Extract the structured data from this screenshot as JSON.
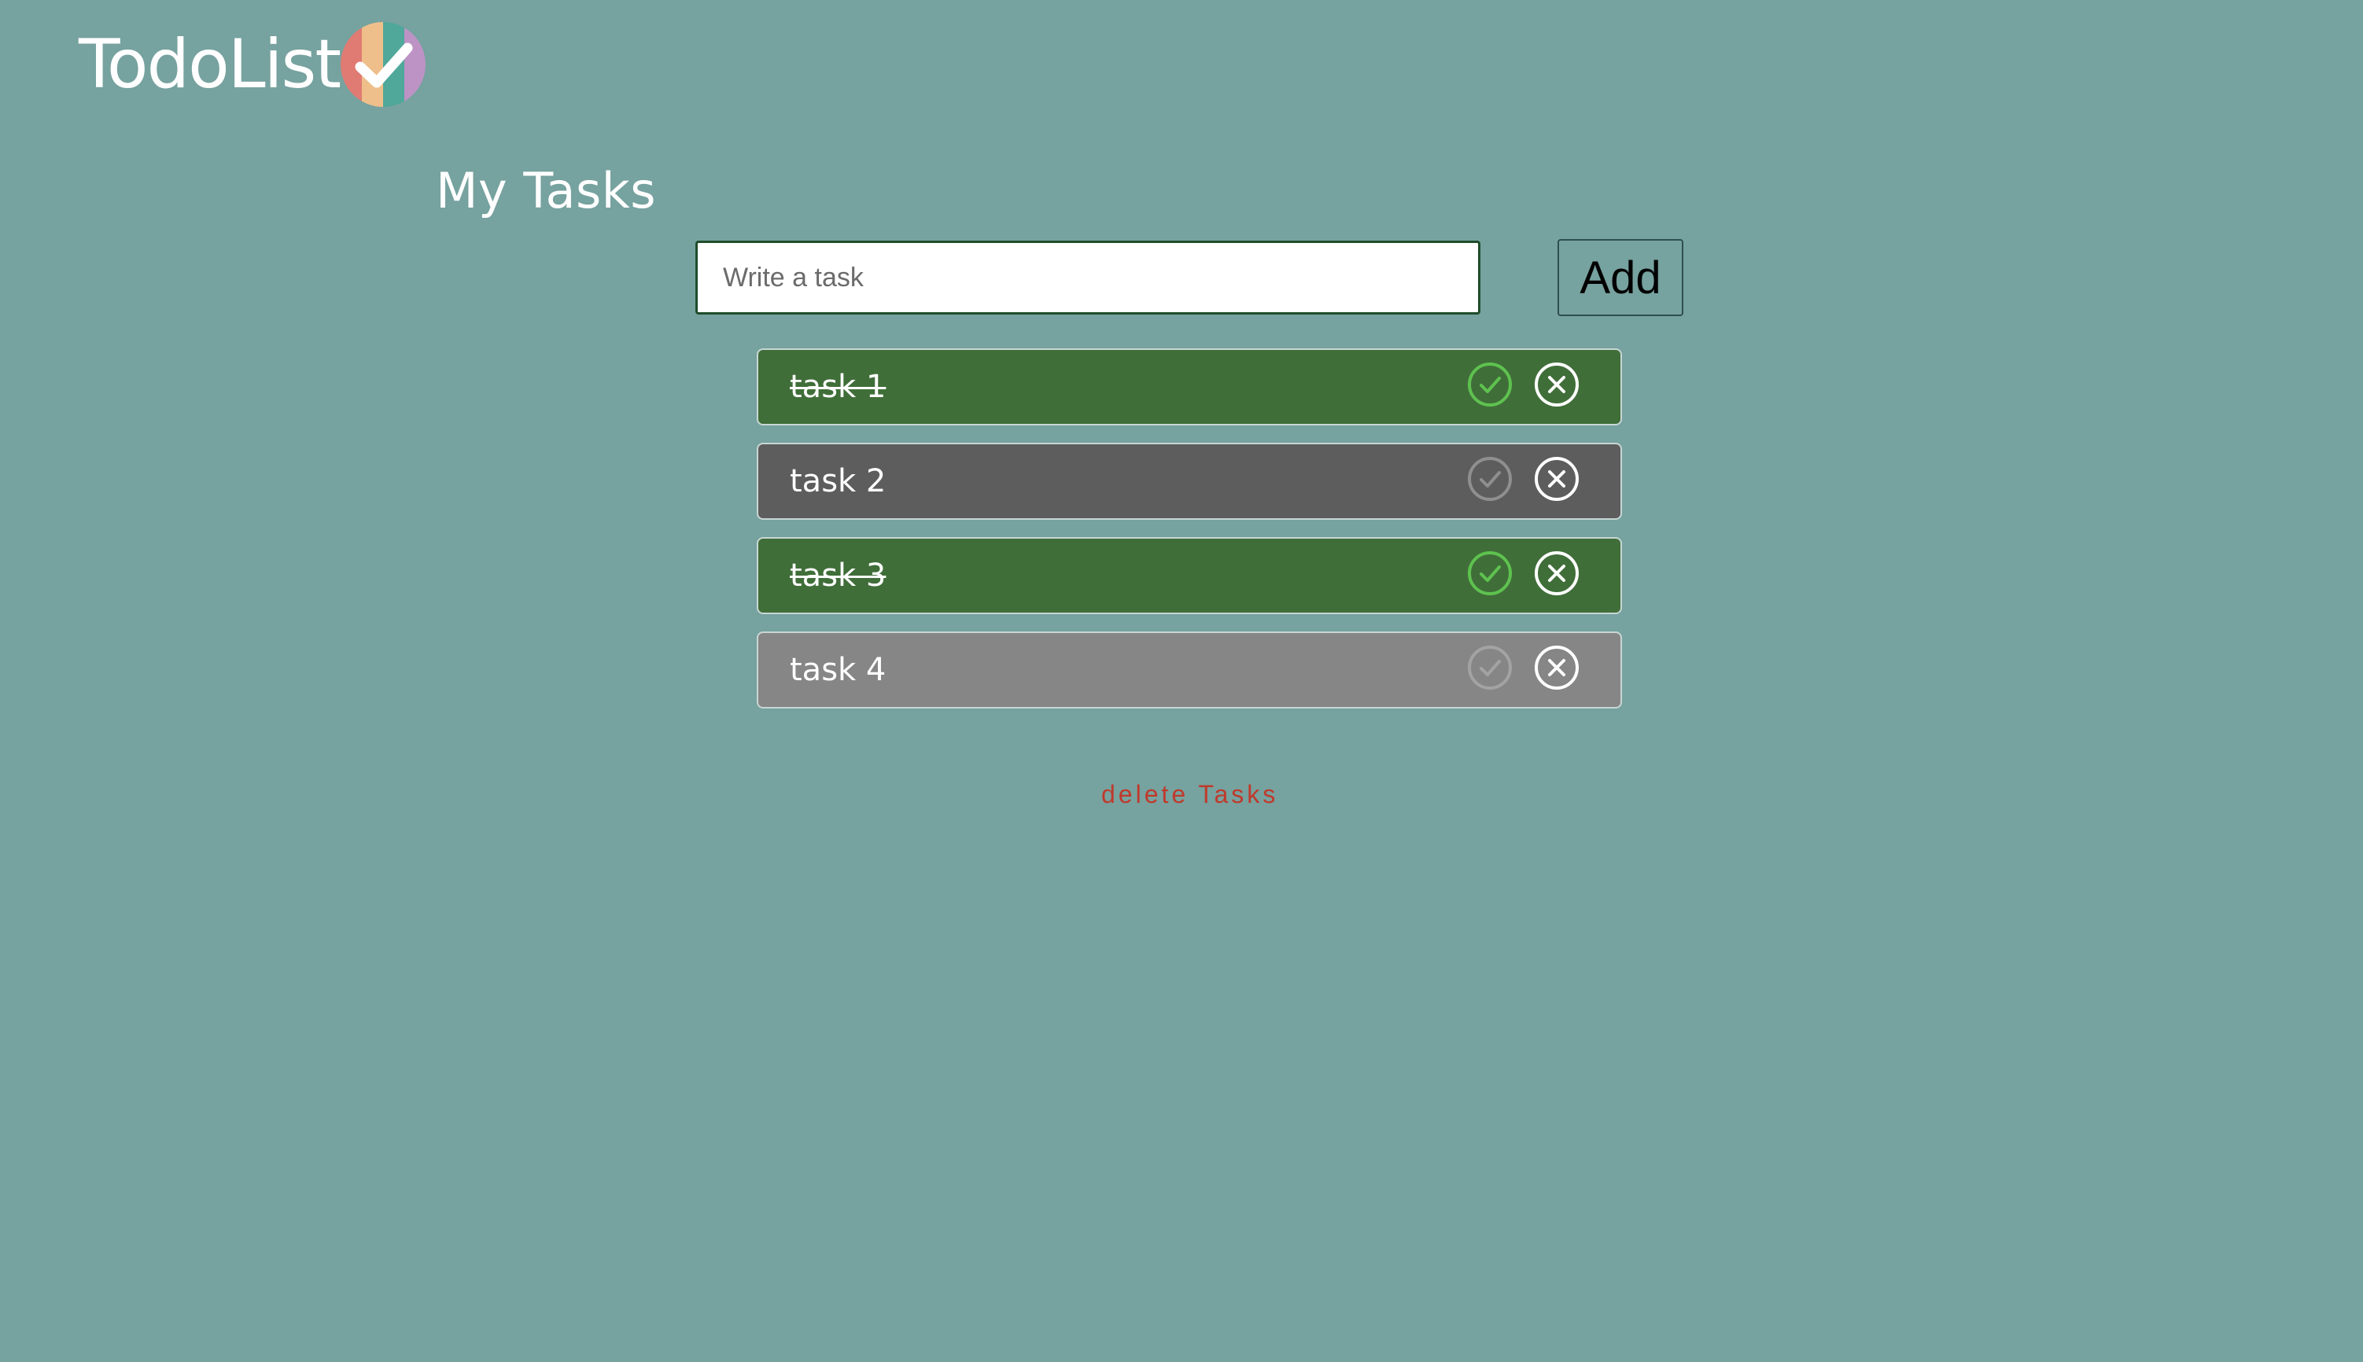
{
  "app": {
    "name": "TodoList",
    "logo_icon": "rainbow-check-logo-icon",
    "logo_stripe_colors": [
      "#e07b73",
      "#eebf8a",
      "#4fa89a",
      "#bd93c5"
    ]
  },
  "main": {
    "title": "My Tasks",
    "input": {
      "value": "",
      "placeholder": "Write a task"
    },
    "add_label": "Add",
    "delete_label": "delete Tasks"
  },
  "tasks": [
    {
      "text": "task 1",
      "completed": true,
      "check_icon": "check-circle-icon",
      "remove_icon": "close-circle-icon"
    },
    {
      "text": "task 2",
      "completed": false,
      "check_icon": "check-circle-icon",
      "remove_icon": "close-circle-icon"
    },
    {
      "text": "task 3",
      "completed": true,
      "check_icon": "check-circle-icon",
      "remove_icon": "close-circle-icon"
    },
    {
      "text": "task 4",
      "completed": false,
      "check_icon": "check-circle-icon",
      "remove_icon": "close-circle-icon"
    }
  ],
  "colors": {
    "background": "#76a29f",
    "completed_task": "#406e39",
    "pending_task": "#5d5d5d",
    "pending_task_light": "#878686",
    "completed_check": "#5ec24f",
    "pending_check": "#a3a3a3",
    "delete_link": "#c0392b"
  }
}
